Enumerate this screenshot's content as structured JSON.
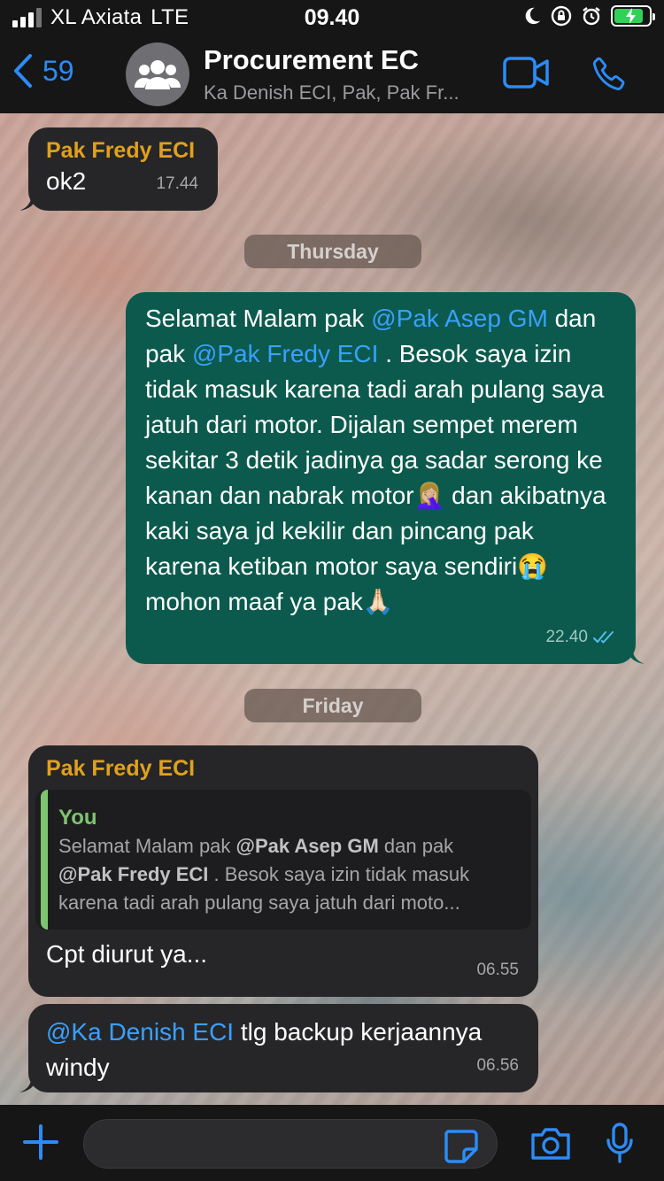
{
  "status_bar": {
    "carrier": "XL Axiata",
    "network": "LTE",
    "time": "09.40",
    "battery_level": 0.85
  },
  "header": {
    "back_count": "59",
    "title": "Procurement EC",
    "subtitle": "Ka Denish ECI, Pak, Pak Fr..."
  },
  "messages": [
    {
      "sender": "Pak Fredy ECI",
      "text": "ok2",
      "time": "17.44"
    },
    {
      "day": "Thursday"
    },
    {
      "mention1": "@Pak Asep GM",
      "mention2": "@Pak Fredy ECI",
      "line_a": "Selamat Malam pak ",
      "line_b": "dan pak ",
      "line_c": " . Besok saya izin tidak masuk karena tadi arah pulang saya jatuh dari motor. Dijalan sempet merem sekitar 3 detik jadinya ga sadar serong ke kanan dan nabrak motor🤦🏼‍♀️ dan akibatnya kaki saya jd kekilir dan pincang pak karena ketiban motor saya sendiri😭 mohon maaf ya pak🙏🏻",
      "time": "22.40",
      "status": "read"
    },
    {
      "day": "Friday"
    },
    {
      "sender": "Pak Fredy ECI",
      "quote_author": "You",
      "quote_prefix": "Selamat Malam pak ",
      "quote_mention1": "@Pak Asep GM",
      "quote_mid": " dan pak ",
      "quote_mention2": "@Pak Fredy ECI",
      "quote_suffix": " . Besok saya izin tidak masuk karena tadi arah pulang saya jatuh dari moto...",
      "text": "Cpt diurut ya...",
      "time": "06.55"
    },
    {
      "mention": "@Ka Denish ECI",
      "text": " tlg backup kerjaannya windy",
      "time": "06.56"
    }
  ],
  "composer": {
    "placeholder": "",
    "value": ""
  },
  "icons": {
    "back": "chevron-left-icon",
    "avatar": "group-icon",
    "video": "video-camera-icon",
    "call": "phone-icon",
    "plus": "plus-icon",
    "sticker": "sticker-icon",
    "camera": "camera-icon",
    "mic": "microphone-icon",
    "read_ticks": "double-check-icon"
  },
  "colors": {
    "accent": "#2b8cf6",
    "sender_name": "#e0a11b",
    "outgoing_bubble": "#0b5a4d",
    "incoming_bubble": "#262628",
    "quote_accent": "#7cc56e",
    "mention": "#3aa0ff"
  }
}
